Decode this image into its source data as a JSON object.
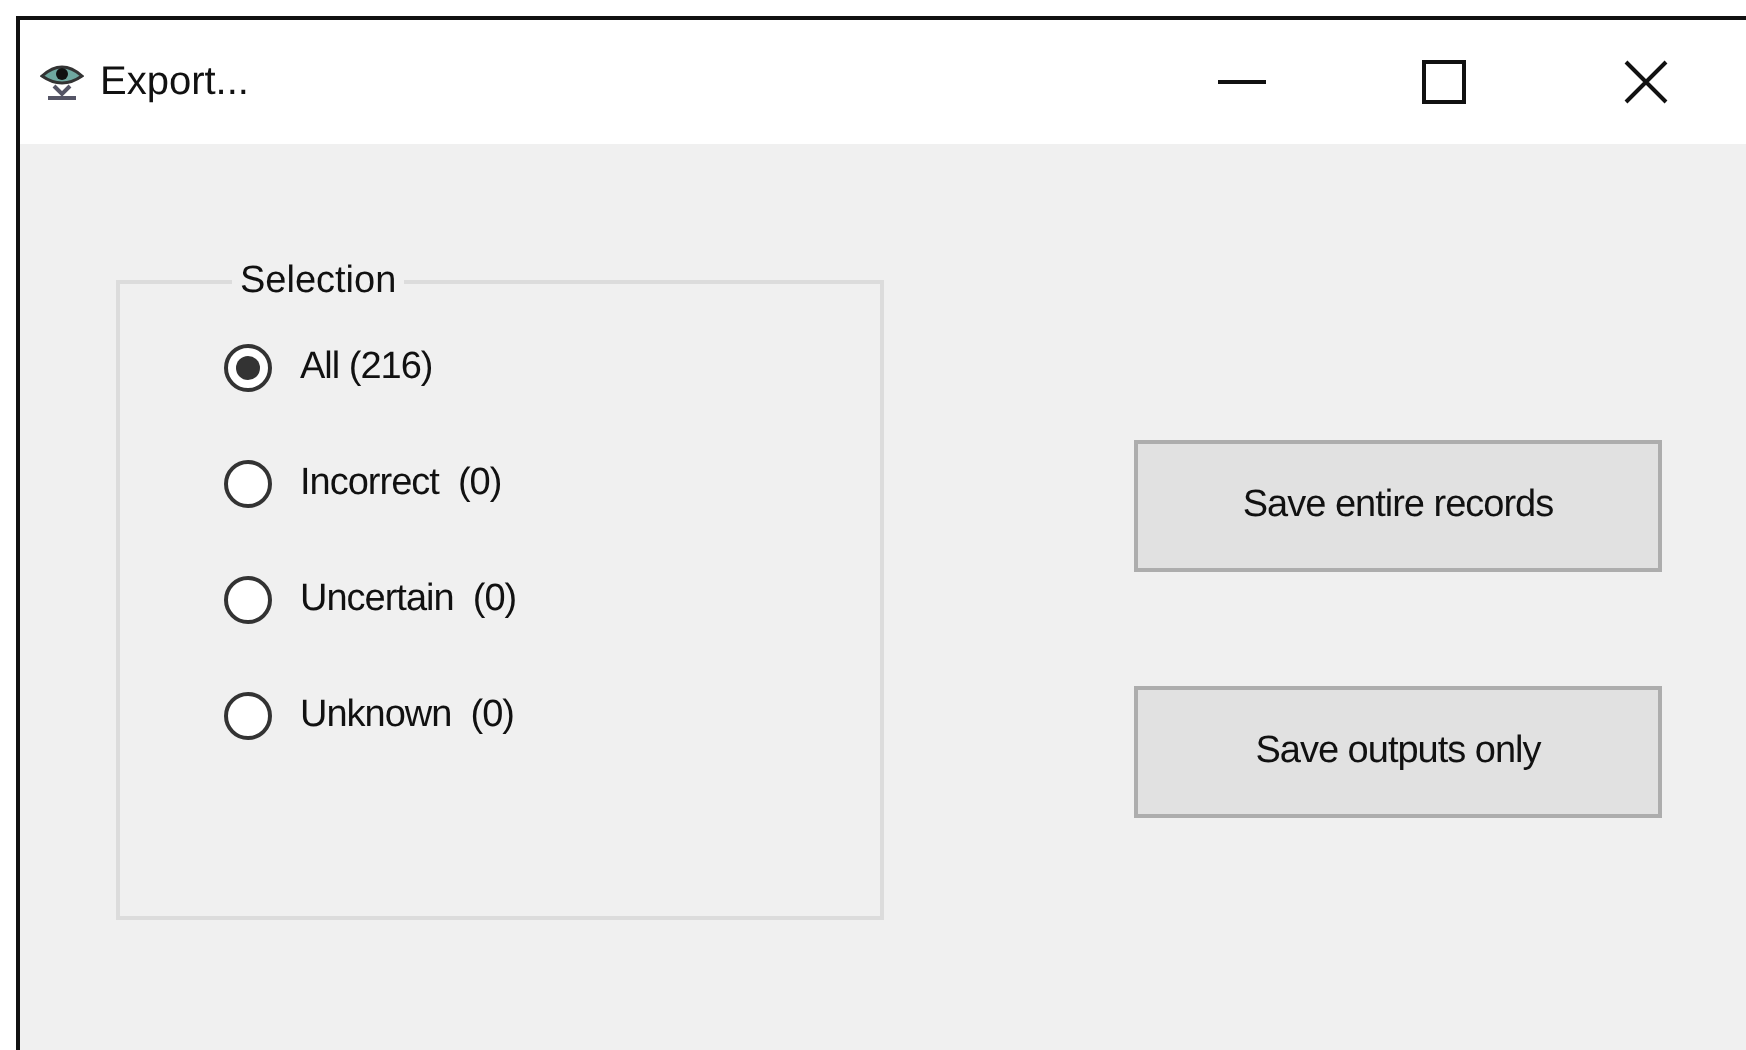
{
  "window": {
    "title": "Export..."
  },
  "selection": {
    "label": "Selection",
    "options": [
      {
        "label": "All (216)",
        "selected": true
      },
      {
        "label": "Incorrect  (0)",
        "selected": false
      },
      {
        "label": "Uncertain  (0)",
        "selected": false
      },
      {
        "label": "Unknown  (0)",
        "selected": false
      }
    ]
  },
  "buttons": [
    "Save entire records",
    "Save outputs only"
  ]
}
